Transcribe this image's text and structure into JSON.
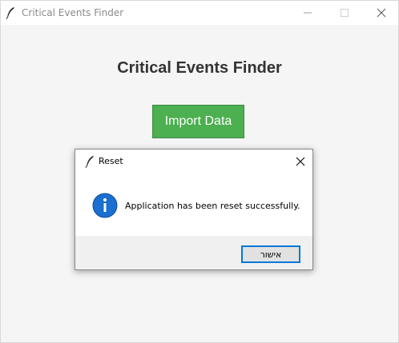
{
  "window": {
    "title": "Critical Events Finder",
    "icon": "feather-icon"
  },
  "main": {
    "heading": "Critical Events Finder",
    "import_button_label": "Import Data",
    "import_button_color": "#4caf50"
  },
  "dialog": {
    "title": "Reset",
    "icon": "info-icon",
    "message": "Application has been reset successfully.",
    "ok_button_label": "אישור",
    "accent_color": "#0078d7"
  }
}
